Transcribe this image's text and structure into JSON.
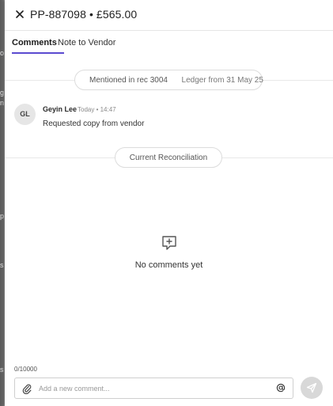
{
  "header": {
    "title": "PP-887098 • £565.00",
    "close_icon": "close-icon"
  },
  "tabs": [
    {
      "label": "Comments",
      "active": true
    },
    {
      "label": "Note to Vendor",
      "active": false
    }
  ],
  "section_rec": {
    "mentioned": "Mentioned in rec 3004",
    "ledger": "Ledger from 31 May 25"
  },
  "comment": {
    "initials": "GL",
    "author": "Geyin Lee",
    "meta": "Today • 14:47",
    "text": "Requested copy from vendor"
  },
  "section_current": {
    "label": "Current Reconciliation"
  },
  "empty_state": {
    "icon": "add-comment-icon",
    "text": "No comments yet"
  },
  "composer": {
    "counter": "0/10000",
    "placeholder": "Add a new comment...",
    "value": "",
    "attach_icon": "paperclip-icon",
    "mention_icon": "at-sign-icon",
    "send_icon": "send-icon"
  },
  "colors": {
    "accent": "#5b4bd0",
    "send_button_bg": "#d8d8d8"
  }
}
